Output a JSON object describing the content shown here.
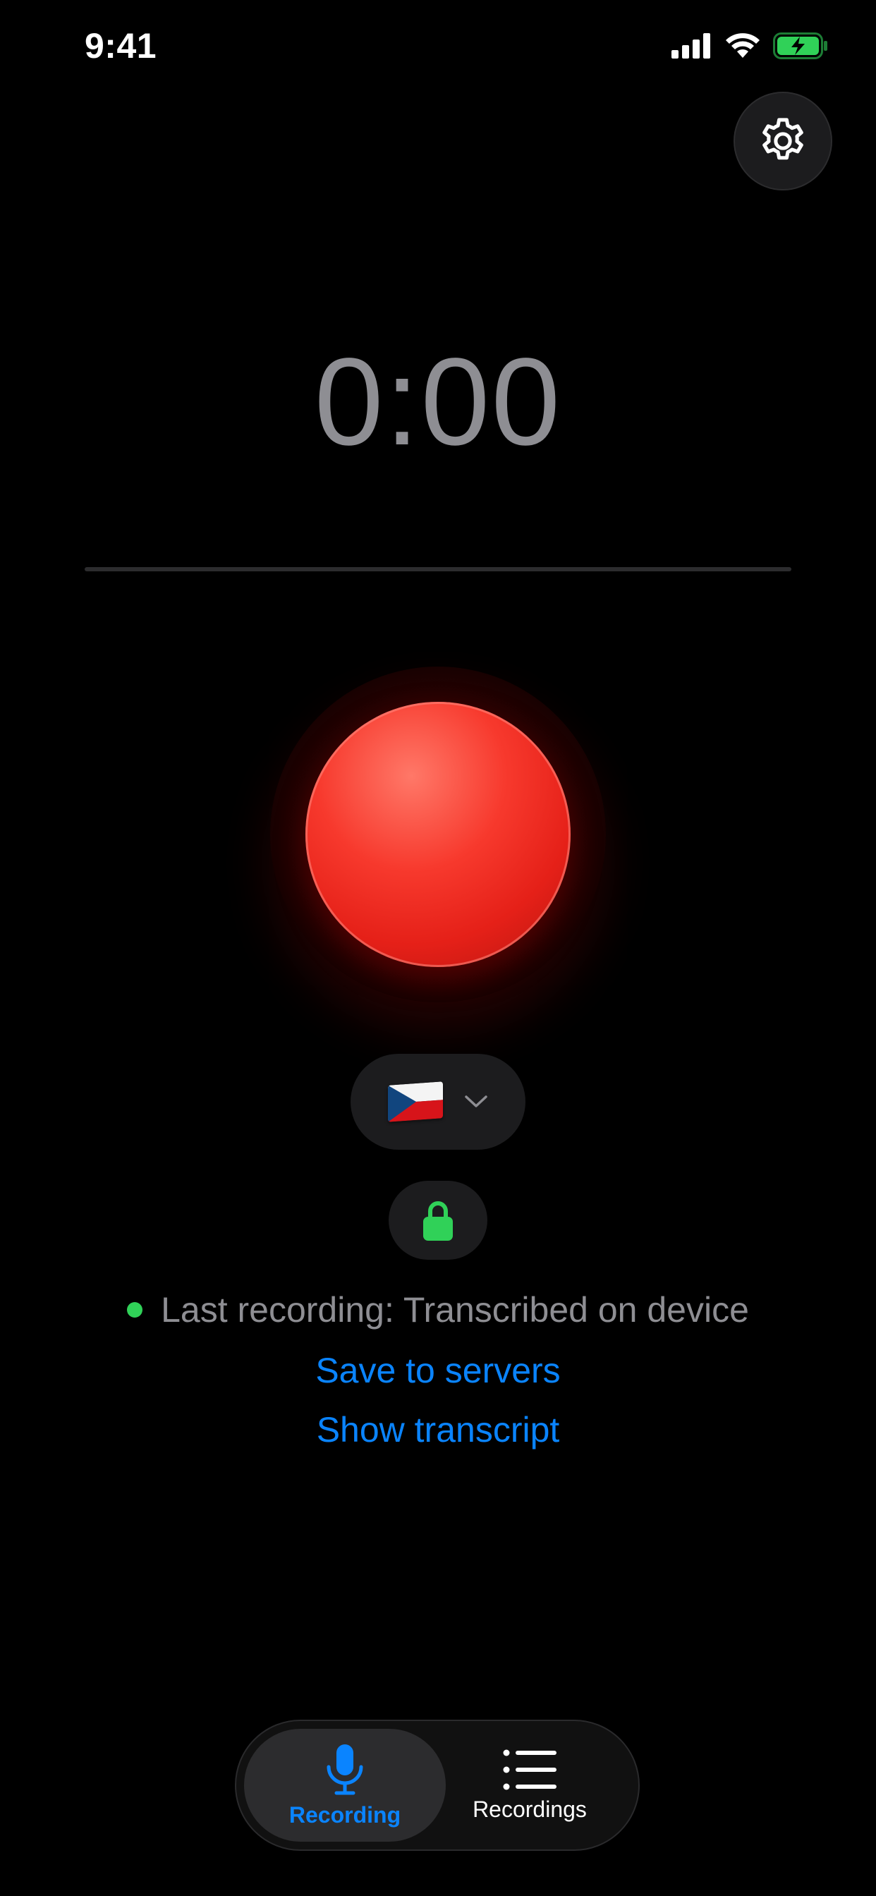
{
  "status_bar": {
    "time": "9:41",
    "icons": [
      "cellular-signal-icon",
      "wifi-icon",
      "battery-charging-icon"
    ],
    "battery_color": "#30d158"
  },
  "header": {
    "settings_icon": "gear-icon"
  },
  "recorder": {
    "timer": "0:00",
    "record_button_color": "#e52018"
  },
  "language": {
    "selected_flag": "Czech flag",
    "chevron_icon": "chevron-down-icon"
  },
  "privacy": {
    "icon": "lock-icon",
    "color": "#30d158"
  },
  "last_recording": {
    "status_dot_color": "#30d158",
    "status_text": "Last recording: Transcribed on device",
    "save_link": "Save to servers",
    "show_link": "Show transcript"
  },
  "tabbar": {
    "tabs": [
      {
        "label": "Recording",
        "icon": "microphone-icon",
        "active": true
      },
      {
        "label": "Recordings",
        "icon": "list-icon",
        "active": false
      }
    ],
    "accent": "#0a84ff"
  }
}
